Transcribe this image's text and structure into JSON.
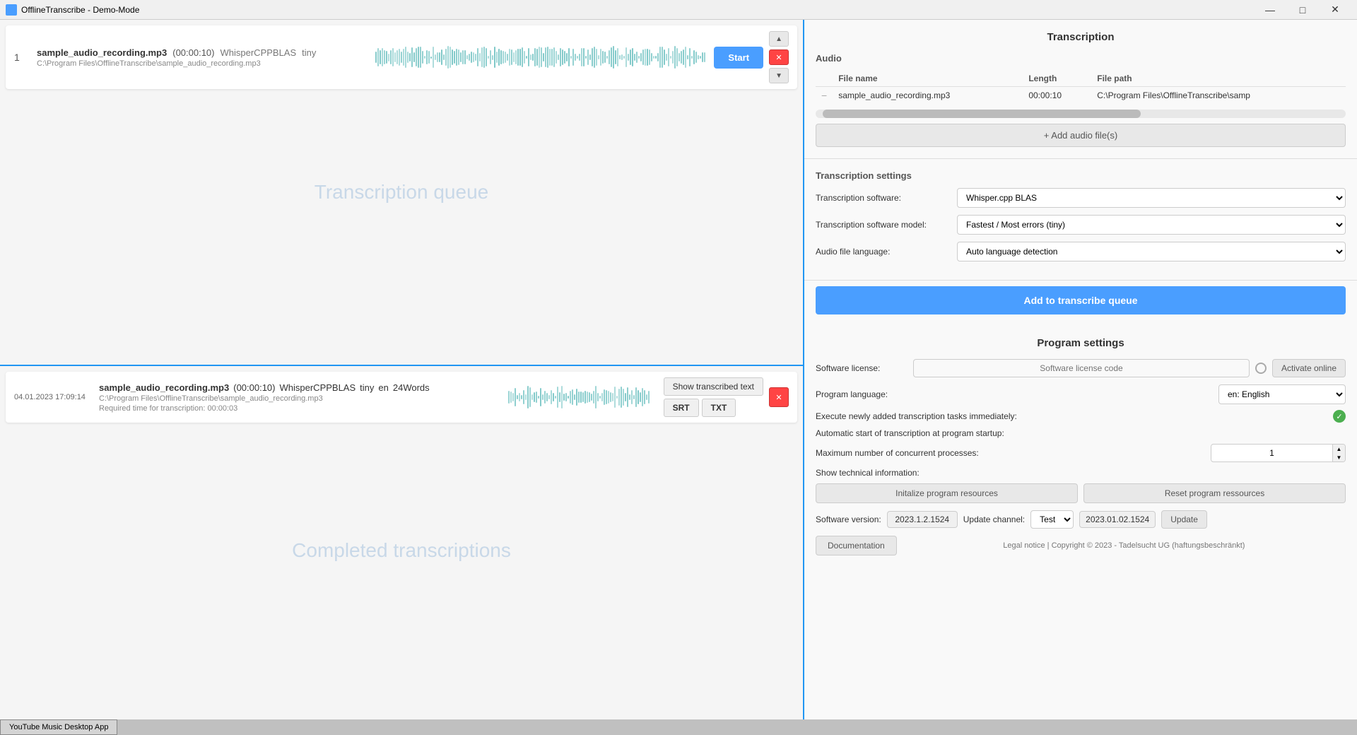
{
  "titleBar": {
    "title": "OfflineTranscribe - Demo-Mode",
    "minimizeBtn": "—",
    "maximizeBtn": "□",
    "closeBtn": "✕"
  },
  "leftPanel": {
    "queueSection": {
      "watermark": "Transcription queue",
      "item": {
        "number": "1",
        "filename": "sample_audio_recording.mp3",
        "duration": "(00:00:10)",
        "model": "WhisperCPPBLAS",
        "modelSize": "tiny",
        "path": "C:\\Program Files\\OfflineTranscribe\\sample_audio_recording.mp3",
        "startBtn": "Start"
      }
    },
    "completedSection": {
      "watermark": "Completed transcriptions",
      "item": {
        "date": "04.01.2023 17:09:14",
        "filename": "sample_audio_recording.mp3",
        "duration": "(00:00:10)",
        "model": "WhisperCPPBLAS",
        "modelSize": "tiny",
        "language": "en",
        "wordCount": "24Words",
        "path": "C:\\Program Files\\OfflineTranscribe\\sample_audio_recording.mp3",
        "requiredTime": "Required time for transcription: 00:00:03",
        "showTextBtn": "Show transcribed text",
        "srtBtn": "SRT",
        "txtBtn": "TXT"
      }
    }
  },
  "rightPanel": {
    "transcriptionTitle": "Transcription",
    "audioSection": {
      "title": "Audio",
      "columns": {
        "filename": "File name",
        "length": "Length",
        "filepath": "File path"
      },
      "file": {
        "filename": "sample_audio_recording.mp3",
        "length": "00:00:10",
        "filepath": "C:\\Program Files\\OfflineTranscribe\\samp"
      },
      "addBtn": "+ Add audio file(s)"
    },
    "settingsSection": {
      "title": "Transcription settings",
      "softwareLabel": "Transcription software:",
      "softwareValue": "Whisper.cpp BLAS",
      "modelLabel": "Transcription software model:",
      "modelValue": "Fastest / Most errors (tiny)",
      "languageLabel": "Audio file language:",
      "languageValue": "Auto language detection",
      "addToQueueBtn": "Add to transcribe queue"
    },
    "programSettings": {
      "title": "Program settings",
      "licenseLabel": "Software license:",
      "licensePlaceholder": "Software license code",
      "activateBtn": "Activate online",
      "programLangLabel": "Program language:",
      "programLangValue": "en: English",
      "executeLabel": "Execute newly added transcription tasks immediately:",
      "autoStartLabel": "Automatic start of transcription at program startup:",
      "maxProcessesLabel": "Maximum number of concurrent processes:",
      "maxProcessesValue": "1",
      "technicalInfoLabel": "Show technical information:",
      "initBtn": "Initalize program resources",
      "resetBtn": "Reset program ressources",
      "versionLabel": "Software version:",
      "versionValue": "2023.1.2.1524",
      "updateChannelLabel": "Update channel:",
      "updateChannelValue": "Test",
      "updateDateValue": "2023.01.02.1524",
      "updateBtn": "Update",
      "documentationBtn": "Documentation",
      "copyrightText": "Legal notice | Copyright © 2023 - Tadelsucht UG (haftungsbeschränkt)"
    }
  },
  "taskbar": {
    "item": "YouTube Music Desktop App"
  }
}
